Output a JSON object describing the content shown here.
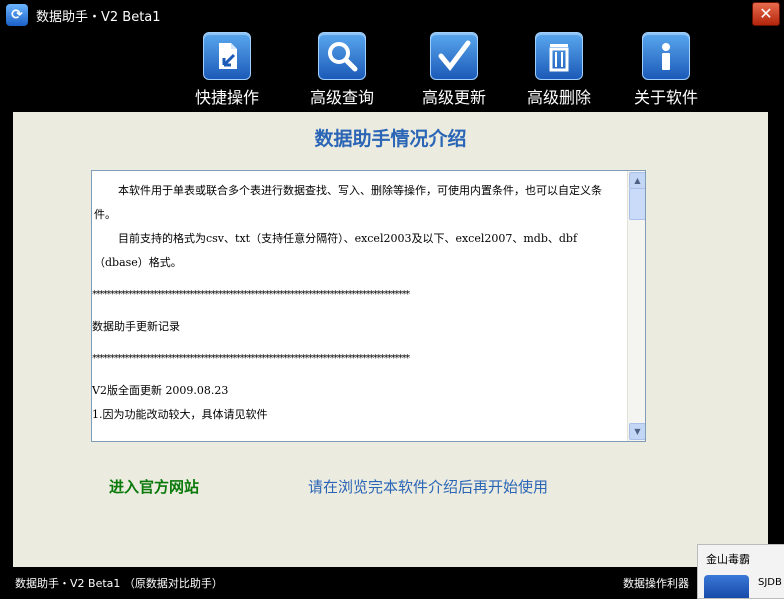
{
  "window": {
    "title": "数据助手・V2 Beta1",
    "close_label": "✕"
  },
  "toolbar": {
    "items": [
      {
        "label": "快捷操作",
        "icon": "quick-action-icon"
      },
      {
        "label": "高级查询",
        "icon": "magnifier-icon"
      },
      {
        "label": "高级更新",
        "icon": "checkmark-icon"
      },
      {
        "label": "高级删除",
        "icon": "trash-bin-icon"
      },
      {
        "label": "关于软件",
        "icon": "info-icon"
      }
    ]
  },
  "main": {
    "heading": "数据助手情况介绍",
    "intro": {
      "para1": "本软件用于单表或联合多个表进行数据查找、写入、删除等操作，可使用内置条件，也可以自定义条件。",
      "para2": "目前支持的格式为csv、txt（支持任意分隔符）、excel2003及以下、excel2007、mdb、dbf（dbase）格式。",
      "stars1": "****************************************************************************************",
      "changelog_title": "数据助手更新记录",
      "stars2": "****************************************************************************************",
      "version_line": "V2版全面更新   2009.08.23",
      "item1": "1.因为功能改动较大，具体请见软件"
    },
    "official_site_link": "进入官方网站",
    "notice": "请在浏览完本软件介绍后再开始使用"
  },
  "statusbar": {
    "left": "数据助手・V2 Beta1 （原数据对比助手）",
    "right": "数据操作利器"
  },
  "popup": {
    "title": "金山毒霸",
    "text": "SJDB"
  },
  "colors": {
    "accent_blue": "#2a65b6",
    "link_green": "#0a7a0a",
    "panel_bg": "#ecebdf",
    "frame_bg": "#000000"
  }
}
